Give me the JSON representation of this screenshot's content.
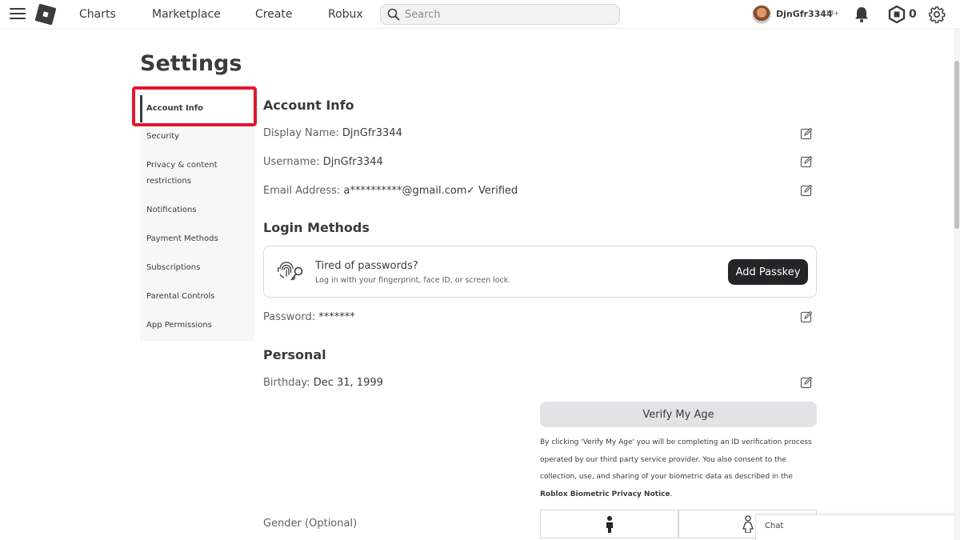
{
  "nav": {
    "links": [
      "Charts",
      "Marketplace",
      "Create",
      "Robux"
    ],
    "search_placeholder": "Search",
    "username": "DjnGfr3344",
    "age_badge": "13+",
    "robux": "0"
  },
  "page": {
    "title": "Settings"
  },
  "sidebar": {
    "items": [
      "Account Info",
      "Security",
      "Privacy & content",
      "restrictions",
      "Notifications",
      "Payment Methods",
      "Subscriptions",
      "Parental Controls",
      "App Permissions"
    ],
    "active": "Account Info"
  },
  "account_info": {
    "title": "Account Info",
    "display_name_label": "Display Name: ",
    "display_name": "DjnGfr3344",
    "username_label": "Username: ",
    "username": "DjnGfr3344",
    "email_label": "Email Address: ",
    "email": "a**********@gmail.com",
    "verified": "Verified"
  },
  "login_methods": {
    "title": "Login Methods",
    "passkey_title": "Tired of passwords?",
    "passkey_desc": "Log in with your fingerprint, face ID, or screen lock.",
    "passkey_button": "Add Passkey",
    "password_label": "Password: ",
    "password": "*******"
  },
  "personal": {
    "title": "Personal",
    "birthday_label": "Birthday: ",
    "birthday": "Dec 31, 1999",
    "verify_button": "Verify My Age",
    "verify_note_1": "By clicking 'Verify My Age' you will be completing an ID verification process operated by our third party service provider. You also consent to the collection, use, and sharing of your biometric data as described in the ",
    "verify_note_link": "Roblox Biometric Privacy Notice",
    "verify_note_2": ".",
    "gender_label": "Gender (Optional)"
  },
  "chat": {
    "label": "Chat"
  },
  "colors": {
    "highlight": "#e3172f",
    "dark_button": "#232527",
    "text": "#393b3d"
  }
}
